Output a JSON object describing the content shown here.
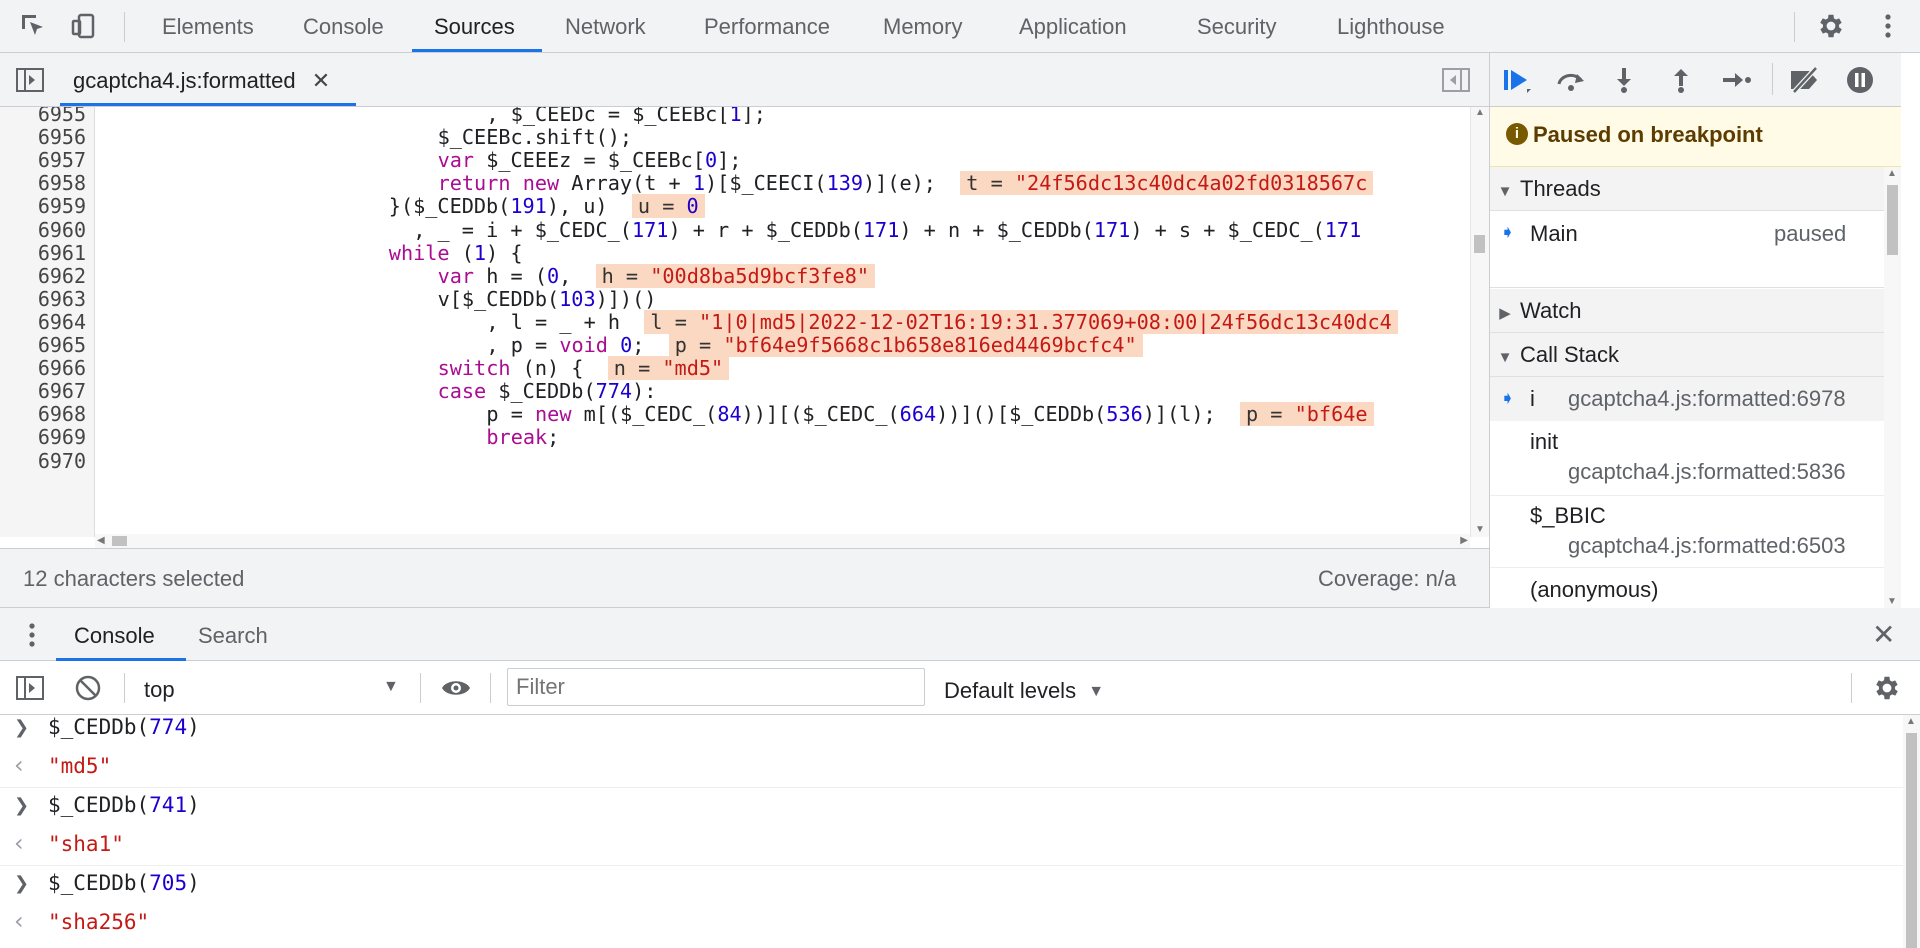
{
  "top_tabs": [
    "Elements",
    "Console",
    "Sources",
    "Network",
    "Performance",
    "Memory",
    "Application",
    "Security",
    "Lighthouse"
  ],
  "active_top_tab": "Sources",
  "editor": {
    "file_tab": "gcaptcha4.js:formatted",
    "lines": [
      {
        "n": "6955",
        "indent": 16,
        "parts": [
          {
            "t": ", $_CEEDc = $_CEEBc["
          },
          {
            "t": "1",
            "c": "nm"
          },
          {
            "t": "];"
          }
        ]
      },
      {
        "n": "6956",
        "indent": 14,
        "parts": [
          {
            "t": "$_CEEBc.shift();"
          }
        ]
      },
      {
        "n": "6957",
        "indent": 14,
        "parts": [
          {
            "t": "var",
            "c": "kw"
          },
          {
            "t": " $_CEEEz = $_CEEBc["
          },
          {
            "t": "0",
            "c": "nm"
          },
          {
            "t": "];"
          }
        ]
      },
      {
        "n": "6958",
        "indent": 14,
        "parts": [
          {
            "t": "return",
            "c": "kw"
          },
          {
            "t": " "
          },
          {
            "t": "new",
            "c": "kw"
          },
          {
            "t": " Array(t + "
          },
          {
            "t": "1",
            "c": "nm"
          },
          {
            "t": ")[$_CEECI("
          },
          {
            "t": "139",
            "c": "nm"
          },
          {
            "t": ")](e);  "
          },
          {
            "t": "t = ",
            "c": "inl",
            "v": "\"24f56dc13c40dc4a02fd0318567c",
            "vc": "st"
          }
        ]
      },
      {
        "n": "6959",
        "indent": 12,
        "parts": [
          {
            "t": "}($_CEDDb("
          },
          {
            "t": "191",
            "c": "nm"
          },
          {
            "t": "), u)  "
          },
          {
            "t": "u = ",
            "c": "inl",
            "v": "0",
            "vc": "nm"
          }
        ]
      },
      {
        "n": "6960",
        "indent": 13,
        "parts": [
          {
            "t": ", _ = i + $_CEDC_("
          },
          {
            "t": "171",
            "c": "nm"
          },
          {
            "t": ") + r + $_CEDDb("
          },
          {
            "t": "171",
            "c": "nm"
          },
          {
            "t": ") + n + $_CEDDb("
          },
          {
            "t": "171",
            "c": "nm"
          },
          {
            "t": ") + s + $_CEDC_("
          },
          {
            "t": "171",
            "c": "nm"
          }
        ]
      },
      {
        "n": "6961",
        "indent": 12,
        "parts": [
          {
            "t": "while",
            "c": "kw"
          },
          {
            "t": " ("
          },
          {
            "t": "1",
            "c": "nm"
          },
          {
            "t": ") {"
          }
        ]
      },
      {
        "n": "6962",
        "indent": 14,
        "parts": [
          {
            "t": "var",
            "c": "kw"
          },
          {
            "t": " h = ("
          },
          {
            "t": "0",
            "c": "nm"
          },
          {
            "t": ",  "
          },
          {
            "t": "h = ",
            "c": "inl",
            "v": "\"00d8ba5d9bcf3fe8\"",
            "vc": "st"
          }
        ]
      },
      {
        "n": "6963",
        "indent": 14,
        "parts": [
          {
            "t": "v[$_CEDDb("
          },
          {
            "t": "103",
            "c": "nm"
          },
          {
            "t": ")])()"
          }
        ]
      },
      {
        "n": "6964",
        "indent": 16,
        "parts": [
          {
            "t": ", l = _ + h  "
          },
          {
            "t": "l = ",
            "c": "inl",
            "v": "\"1|0|md5|2022-12-02T16:19:31.377069+08:00|24f56dc13c40dc4",
            "vc": "st"
          }
        ]
      },
      {
        "n": "6965",
        "indent": 16,
        "parts": [
          {
            "t": ", p = "
          },
          {
            "t": "void",
            "c": "kw"
          },
          {
            "t": " "
          },
          {
            "t": "0",
            "c": "nm"
          },
          {
            "t": ";  "
          },
          {
            "t": "p = ",
            "c": "inl",
            "v": "\"bf64e9f5668c1b658e816ed4469bcfc4\"",
            "vc": "st"
          }
        ]
      },
      {
        "n": "6966",
        "indent": 14,
        "parts": [
          {
            "t": "switch",
            "c": "kw"
          },
          {
            "t": " (n) {  "
          },
          {
            "t": "n = ",
            "c": "inl",
            "v": "\"md5\"",
            "vc": "st"
          }
        ]
      },
      {
        "n": "6967",
        "indent": 14,
        "parts": [
          {
            "t": "case",
            "c": "kw"
          },
          {
            "t": " $_CEDDb("
          },
          {
            "t": "774",
            "c": "nm"
          },
          {
            "t": "):"
          }
        ]
      },
      {
        "n": "6968",
        "indent": 16,
        "parts": [
          {
            "t": "p = "
          },
          {
            "t": "new",
            "c": "kw"
          },
          {
            "t": " m[($_CEDC_("
          },
          {
            "t": "84",
            "c": "nm"
          },
          {
            "t": "))][($_CEDC_("
          },
          {
            "t": "664",
            "c": "nm"
          },
          {
            "t": "))]()[$_CEDDb("
          },
          {
            "t": "536",
            "c": "nm"
          },
          {
            "t": ")](l);  "
          },
          {
            "t": "p = ",
            "c": "inl",
            "v": "\"bf64e",
            "vc": "st"
          }
        ]
      },
      {
        "n": "6969",
        "indent": 16,
        "parts": [
          {
            "t": "break",
            "c": "kw"
          },
          {
            "t": ";"
          }
        ]
      },
      {
        "n": "6970",
        "indent": 0,
        "parts": []
      }
    ]
  },
  "status": {
    "selection": "12 characters selected",
    "coverage": "Coverage: n/a"
  },
  "debugger": {
    "paused_message": "Paused on breakpoint",
    "threads_label": "Threads",
    "thread_name": "Main",
    "thread_state": "paused",
    "watch_label": "Watch",
    "callstack_label": "Call Stack",
    "frames": [
      {
        "fn": "i",
        "loc": "gcaptcha4.js:formatted:6978",
        "current": true
      },
      {
        "fn": "init",
        "loc": "gcaptcha4.js:formatted:5836",
        "current": false
      },
      {
        "fn": "$_BBIC",
        "loc": "gcaptcha4.js:formatted:6503",
        "current": false
      },
      {
        "fn": "(anonymous)",
        "loc": "",
        "current": false
      }
    ]
  },
  "drawer": {
    "tabs": [
      "Console",
      "Search"
    ],
    "context": "top",
    "filter_placeholder": "Filter",
    "levels": "Default levels"
  },
  "console": [
    {
      "type": "input",
      "parts": [
        {
          "t": "$_CEDDb("
        },
        {
          "t": "774",
          "c": "nm"
        },
        {
          "t": ")"
        }
      ]
    },
    {
      "type": "output",
      "parts": [
        {
          "t": "\"md5\"",
          "c": "st"
        }
      ]
    },
    {
      "type": "input",
      "parts": [
        {
          "t": "$_CEDDb("
        },
        {
          "t": "741",
          "c": "nm"
        },
        {
          "t": ")"
        }
      ]
    },
    {
      "type": "output",
      "parts": [
        {
          "t": "\"sha1\"",
          "c": "st"
        }
      ]
    },
    {
      "type": "input",
      "parts": [
        {
          "t": "$_CEDDb("
        },
        {
          "t": "705",
          "c": "nm"
        },
        {
          "t": ")"
        }
      ]
    },
    {
      "type": "output",
      "parts": [
        {
          "t": "\"sha256\"",
          "c": "st"
        }
      ]
    }
  ],
  "colors": {
    "accent": "#1a73e8",
    "paused_bg": "#fffbe6",
    "inline_value_bg": "#fbd8c2"
  }
}
